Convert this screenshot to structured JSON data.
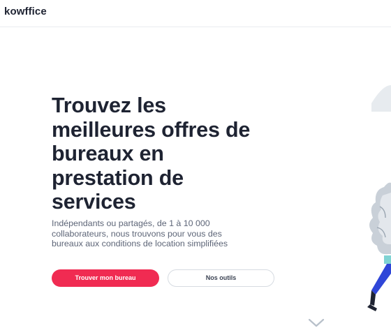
{
  "header": {
    "logo": "kowffice"
  },
  "hero": {
    "title": "Trouvez les meilleures offres de bureaux en prestation de services",
    "subtitle": "Indépendants ou partagés, de 1 à 10 000 collaborateurs, nous trouvons pour vous des bureaux aux conditions de location simplifiées",
    "primary_button": "Trouver mon bureau",
    "secondary_button": "Nos outils"
  },
  "colors": {
    "primary": "#f02b52",
    "text_dark": "#1e2332",
    "text_muted": "#5d6577",
    "border": "#d6dbe1",
    "illustration_blue": "#2f46d8",
    "illustration_teal": "#7fd3d3"
  },
  "icons": [
    "chevron-down-icon"
  ]
}
